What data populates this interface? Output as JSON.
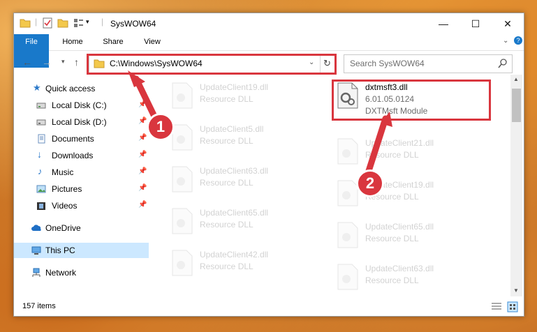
{
  "window": {
    "title": "SysWOW64",
    "controls": {
      "minimize": "—",
      "maximize": "☐",
      "close": "✕"
    }
  },
  "ribbon": {
    "tabs": [
      {
        "label": "File"
      },
      {
        "label": "Home"
      },
      {
        "label": "Share"
      },
      {
        "label": "View"
      }
    ]
  },
  "address": {
    "path": "C:\\Windows\\SysWOW64",
    "search_placeholder": "Search SysWOW64"
  },
  "sidebar": {
    "items": [
      {
        "label": "Quick access",
        "icon": "star-icon"
      },
      {
        "label": "Local Disk (C:)",
        "icon": "drive-icon",
        "pinned": true
      },
      {
        "label": "Local Disk (D:)",
        "icon": "drive-icon",
        "pinned": true
      },
      {
        "label": "Documents",
        "icon": "documents-icon",
        "pinned": true
      },
      {
        "label": "Downloads",
        "icon": "download-icon",
        "pinned": true
      },
      {
        "label": "Music",
        "icon": "music-icon",
        "pinned": true
      },
      {
        "label": "Pictures",
        "icon": "pictures-icon",
        "pinned": true
      },
      {
        "label": "Videos",
        "icon": "videos-icon",
        "pinned": true
      },
      {
        "label": "OneDrive",
        "icon": "cloud-icon"
      },
      {
        "label": "This PC",
        "icon": "pc-icon",
        "selected": true
      },
      {
        "label": "Network",
        "icon": "network-icon"
      }
    ]
  },
  "files": {
    "highlighted": {
      "name": "dxtmsft3.dll",
      "version": "6.01.05.0124",
      "description": "DXTMsft Module"
    },
    "left_column": [
      {
        "name": "UpdateClient19.dll",
        "type": "Resource DLL"
      },
      {
        "name": "UpdateClient5.dll",
        "type": "Resource DLL"
      },
      {
        "name": "UpdateClient63.dll",
        "type": "Resource DLL"
      },
      {
        "name": "UpdateClient65.dll",
        "type": "Resource DLL"
      },
      {
        "name": "UpdateClient42.dll",
        "type": "Resource DLL"
      }
    ],
    "right_column": [
      {
        "name": "UpdateClient21.dll",
        "type": "Resource DLL"
      },
      {
        "name": "UpdateClient19.dll",
        "type": "Resource DLL"
      },
      {
        "name": "UpdateClient65.dll",
        "type": "Resource DLL"
      },
      {
        "name": "UpdateClient63.dll",
        "type": "Resource DLL"
      }
    ]
  },
  "status": {
    "item_count": "157 items"
  },
  "callouts": [
    "1",
    "2"
  ],
  "colors": {
    "accent": "#1979ca",
    "highlight": "#d9363e",
    "selection": "#cce8ff"
  }
}
